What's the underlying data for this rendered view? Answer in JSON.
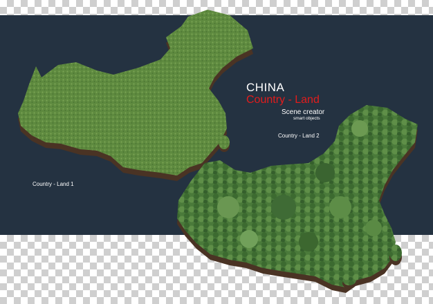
{
  "title": {
    "main": "CHINA",
    "sub": "Country - Land",
    "creator": "Scene creator",
    "small": "smart objects"
  },
  "labels": {
    "land_1": "Country - Land 1",
    "land_2": "Country - Land 2"
  },
  "colors": {
    "panel_background": "#243241",
    "title_main": "#ffffff",
    "title_sub": "#e21c1c",
    "grass": "#5e8a3f",
    "forest": "#3f6b35",
    "soil": "#4a3324"
  }
}
